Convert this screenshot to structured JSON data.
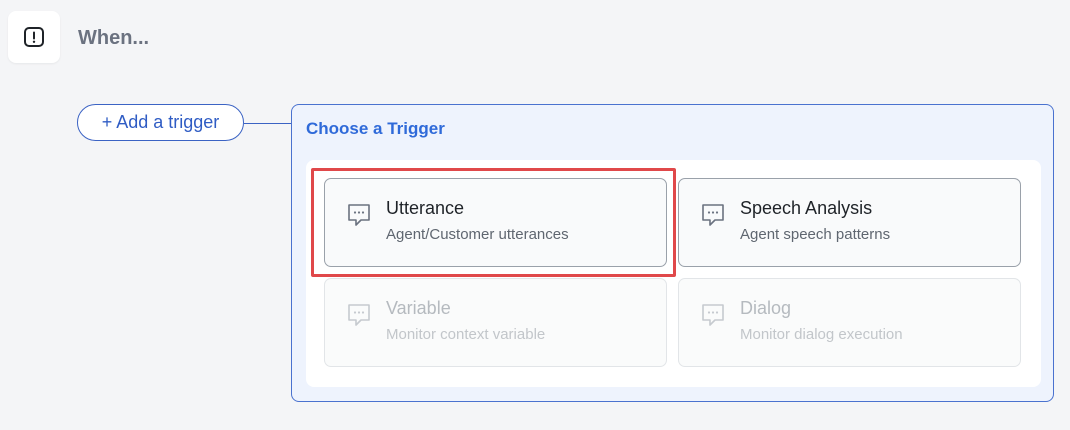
{
  "header": {
    "icon": "alert-square-icon",
    "title": "When..."
  },
  "add_trigger": {
    "label": "+ Add a trigger"
  },
  "panel": {
    "title": "Choose a Trigger",
    "cards": [
      {
        "title": "Utterance",
        "description": "Agent/Customer utterances",
        "icon": "chat-bubble-icon",
        "enabled": true,
        "highlighted": true
      },
      {
        "title": "Speech Analysis",
        "description": "Agent speech patterns",
        "icon": "chat-bubble-icon",
        "enabled": true,
        "highlighted": false
      },
      {
        "title": "Variable",
        "description": "Monitor context variable",
        "icon": "chat-bubble-icon",
        "enabled": false,
        "highlighted": false
      },
      {
        "title": "Dialog",
        "description": "Monitor dialog execution",
        "icon": "chat-bubble-icon",
        "enabled": false,
        "highlighted": false
      }
    ]
  },
  "colors": {
    "accent": "#2f6ad9",
    "highlight": "#e0484a"
  }
}
